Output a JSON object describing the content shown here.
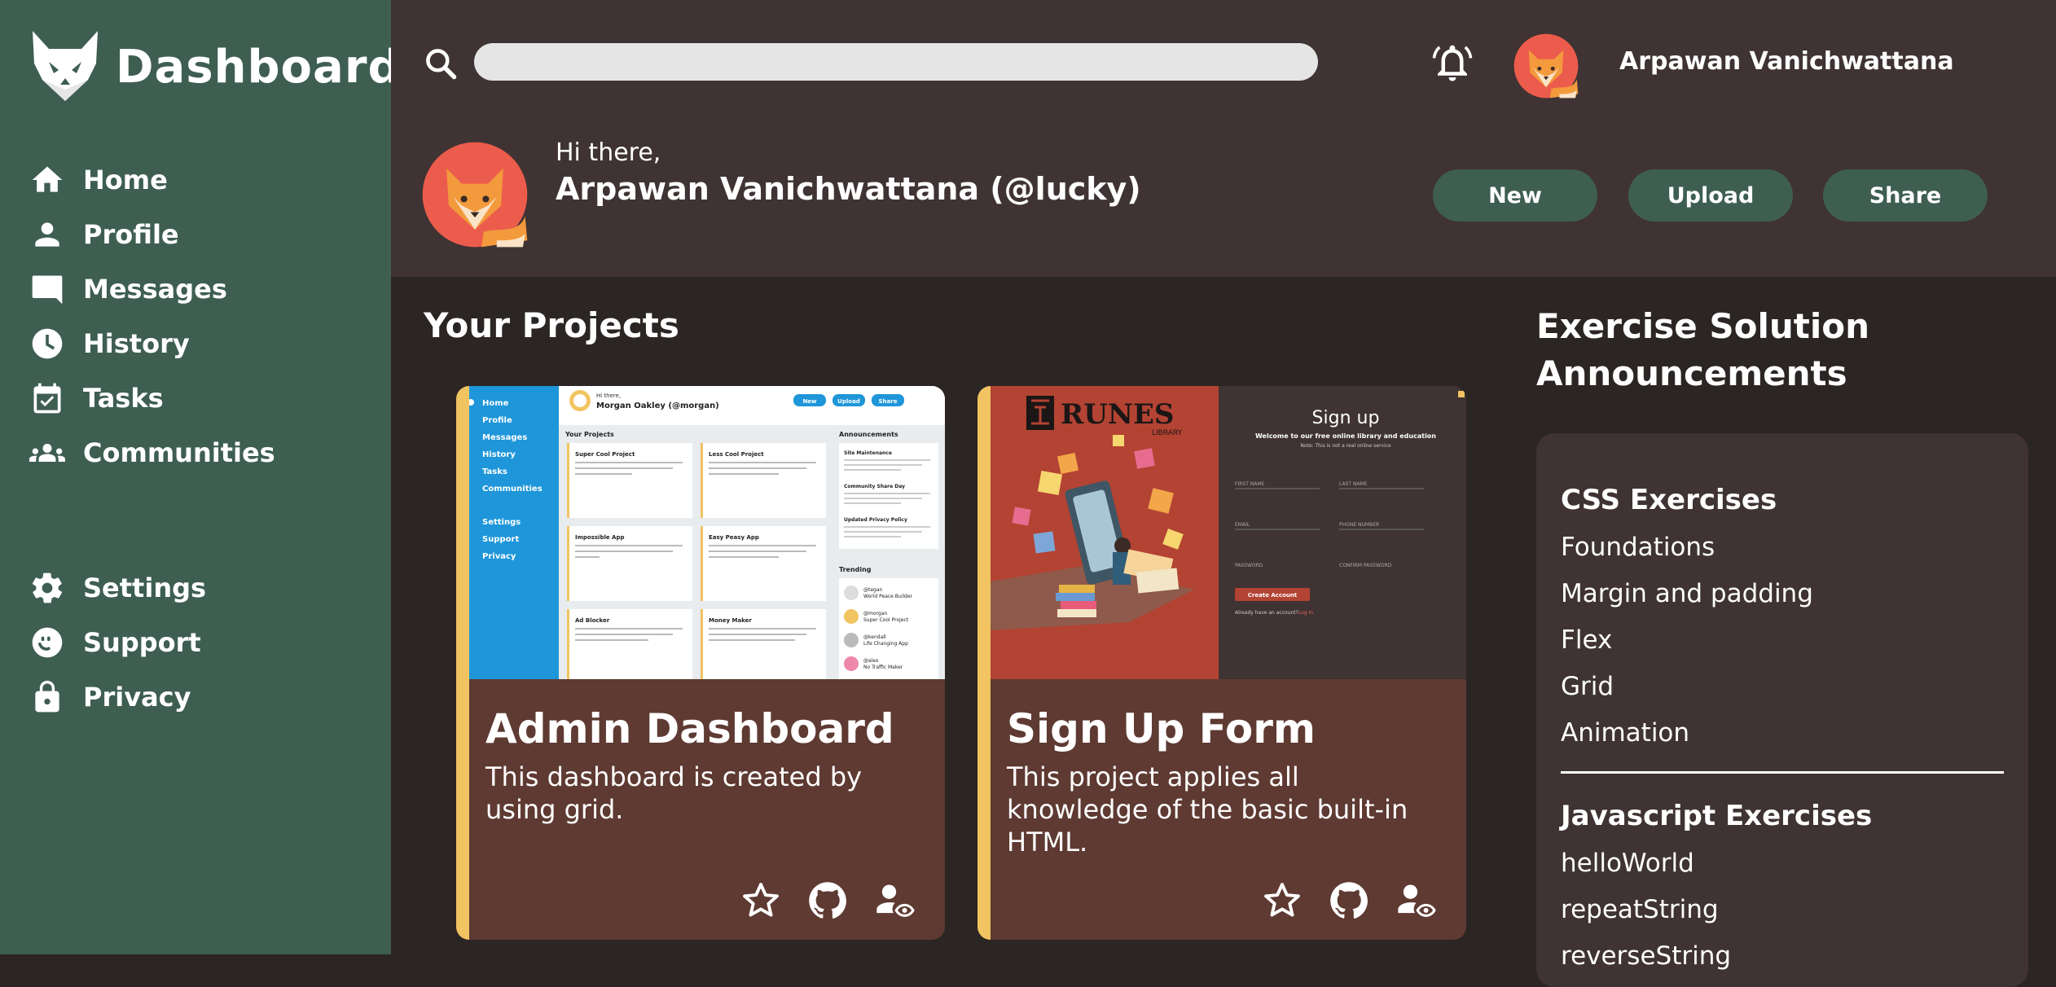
{
  "app": {
    "title": "Dashboard"
  },
  "sidebar": {
    "items": [
      {
        "label": "Home",
        "icon": "home-icon"
      },
      {
        "label": "Profile",
        "icon": "person-icon"
      },
      {
        "label": "Messages",
        "icon": "message-icon"
      },
      {
        "label": "History",
        "icon": "clock-icon"
      },
      {
        "label": "Tasks",
        "icon": "calendar-check-icon"
      },
      {
        "label": "Communities",
        "icon": "group-icon"
      }
    ],
    "secondary": [
      {
        "label": "Settings",
        "icon": "gear-icon"
      },
      {
        "label": "Support",
        "icon": "support-icon"
      },
      {
        "label": "Privacy",
        "icon": "lock-icon"
      }
    ]
  },
  "header": {
    "search": {
      "placeholder": ""
    },
    "user_name": "Arpawan Vanichwattana",
    "greeting": "Hi there,",
    "greeting_name": "Arpawan Vanichwattana (@lucky)",
    "buttons": {
      "new": "New",
      "upload": "Upload",
      "share": "Share"
    }
  },
  "projects": {
    "title": "Your Projects",
    "items": [
      {
        "title": "Admin Dashboard",
        "description": "This dashboard is created by using grid.",
        "thumb": {
          "nav": [
            "Home",
            "Profile",
            "Messages",
            "History",
            "Tasks",
            "Communities",
            "Settings",
            "Support",
            "Privacy"
          ],
          "greeting": "Hi there,",
          "user": "Morgan Oakley (@morgan)",
          "buttons": [
            "New",
            "Upload",
            "Share"
          ],
          "section": "Your Projects",
          "cards": [
            "Super Cool Project",
            "Less Cool Project",
            "Impossible App",
            "Easy Peasy App",
            "Ad Blocker",
            "Money Maker"
          ],
          "announcements_title": "Announcements",
          "announcements": [
            "Site Maintenance",
            "Community Share Day",
            "Updated Privacy Policy"
          ],
          "trending_title": "Trending",
          "trending": [
            {
              "handle": "@tegan",
              "project": "World Peace Builder"
            },
            {
              "handle": "@morgan",
              "project": "Super Cool Project"
            },
            {
              "handle": "@kendall",
              "project": "Life Changing App"
            },
            {
              "handle": "@alex",
              "project": "No Traffic Maker"
            }
          ]
        }
      },
      {
        "title": "Sign Up Form",
        "description": "This project applies all knowledge of the basic built-in HTML.",
        "thumb": {
          "brand": "RUNES",
          "brand_sub": "LIBRARY",
          "heading": "Sign up",
          "subheading": "Welcome to our free online library and education",
          "note": "Note: This is not a real online service",
          "fields": [
            "FIRST NAME",
            "LAST NAME",
            "EMAIL",
            "PHONE NUMBER",
            "PASSWORD",
            "CONFIRM PASSWORD"
          ],
          "submit": "Create Account",
          "footer": "Already have an account?",
          "footer_link": "Log in"
        }
      }
    ]
  },
  "announcements": {
    "title": "Exercise Solution Announcements",
    "groups": [
      {
        "title": "CSS Exercises",
        "items": [
          "Foundations",
          "Margin and padding",
          "Flex",
          "Grid",
          "Animation"
        ]
      },
      {
        "title": "Javascript Exercises",
        "items": [
          "helloWorld",
          "repeatString",
          "reverseString"
        ]
      }
    ]
  },
  "colors": {
    "sidebar": "#3e5e51",
    "header": "#3f3333",
    "background": "#2b2524",
    "card": "#5e3a32",
    "accent": "#f1c461"
  }
}
